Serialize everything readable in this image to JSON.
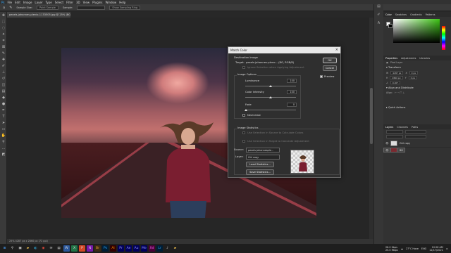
{
  "menu": [
    "File",
    "Edit",
    "Image",
    "Layer",
    "Type",
    "Select",
    "Filter",
    "3D",
    "View",
    "Plugins",
    "Window",
    "Help"
  ],
  "options": {
    "sample_size_label": "Sample Size:",
    "sample_size_value": "Point Sample",
    "sample_label": "Sample:",
    "show_ring": "Show Sampling Ring"
  },
  "document_tab": "pexels-johannes-plenio-1133505.jpg @ 25% (BG, RGB/8) *",
  "status": "25%     4287 px x 2860 px (72 ppi)",
  "panel": {
    "tabs1": [
      "Color",
      "Swatches",
      "Gradients",
      "Patterns"
    ],
    "tabs2": [
      "Properties",
      "Adjustments",
      "Libraries"
    ],
    "pixel_layer": "Pixel Layer",
    "transform": "Transform",
    "w": "4287 px",
    "h": "2860 px",
    "x": "0 px",
    "y": "0 px",
    "angle": "0.00°",
    "align": "Align and Distribute",
    "align_label": "Align:",
    "quick_actions": "Quick Actions",
    "layer_tabs": [
      "Layers",
      "Channels",
      "Paths"
    ],
    "layers": [
      {
        "name": "Girl copy",
        "selected": false
      },
      {
        "name": "BG",
        "selected": true
      }
    ]
  },
  "dialog": {
    "title": "Match Color",
    "dest_image": "Destination Image",
    "target_label": "Target:",
    "target_value": "pexels-johannes-pleno... (BG, RGB/8)",
    "ignore_sel": "Ignore Selection when Applying Adjustment",
    "image_options": "Image Options",
    "luminance": "Luminance",
    "luminance_val": "100",
    "color_intensity": "Color Intensity",
    "color_intensity_val": "100",
    "fade": "Fade",
    "fade_val": "0",
    "neutralize": "Neutralize",
    "image_stats": "Image Statistics",
    "use_sel_source": "Use Selection in Source to Calculate Colors",
    "use_sel_target": "Use Selection in Target to Calculate Adjustment",
    "source_label": "Source:",
    "source_value": "pexels-johannesple...",
    "layer_label": "Layer:",
    "layer_value": "Girl copy",
    "load_stats": "Load Statistics...",
    "save_stats": "Save Statistics...",
    "ok": "OK",
    "cancel": "Cancel",
    "preview": "Preview"
  },
  "taskbar": {
    "icons": [
      "windows-icon",
      "search-icon",
      "task-view-icon",
      "explorer-icon",
      "edge-icon",
      "chrome-icon",
      "mail-icon",
      "store-icon",
      "word-icon",
      "excel-icon",
      "powerpoint-icon",
      "onenote-icon",
      "bridge-icon",
      "photoshop-icon",
      "illustrator-icon",
      "premiere-icon",
      "aftereffects-icon",
      "audition-icon",
      "media-encoder-icon",
      "xd-icon",
      "lightroom-icon",
      "music-icon",
      "folder-icon"
    ],
    "net_up": "26.0 Kbps",
    "net_down": "25.0 Mbps",
    "weather": "27°C  Haze",
    "lang": "ENG",
    "time": "10:26 AM",
    "date": "12/17/2021"
  },
  "colors": {
    "accent": "#3cc414",
    "dialog_bg": "#2f2f2f"
  }
}
